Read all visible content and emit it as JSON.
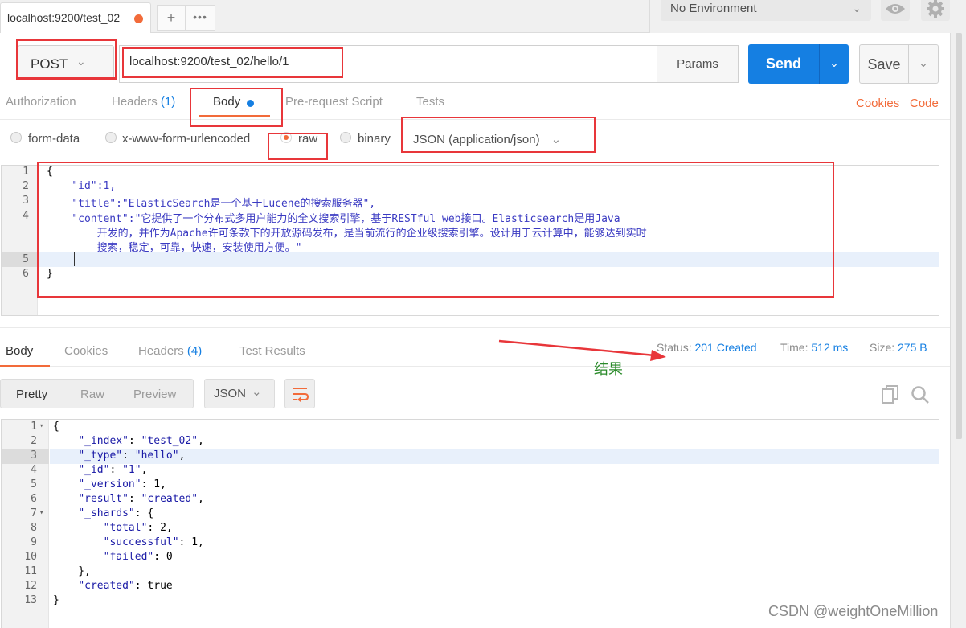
{
  "tabs": {
    "active_label": "localhost:9200/test_02",
    "add_label": "+",
    "more_label": "•••"
  },
  "env": {
    "selected": "No Environment"
  },
  "request": {
    "method": "POST",
    "url": "localhost:9200/test_02/hello/1",
    "params_label": "Params",
    "send_label": "Send",
    "save_label": "Save"
  },
  "req_tabs": {
    "authorization": "Authorization",
    "headers": "Headers",
    "headers_count": "(1)",
    "body": "Body",
    "prerequest": "Pre-request Script",
    "tests": "Tests",
    "cookies": "Cookies",
    "code": "Code"
  },
  "body_modes": {
    "form_data": "form-data",
    "urlencoded": "x-www-form-urlencoded",
    "raw": "raw",
    "binary": "binary",
    "content_type": "JSON (application/json)"
  },
  "request_body": {
    "line_numbers": [
      "1",
      "2",
      "3",
      "4",
      "5",
      "6"
    ],
    "lines": [
      "{",
      "    \"id\":1,",
      "    \"title\":\"ElasticSearch是一个基于Lucene的搜索服务器\",",
      "    \"content\":\"它提供了一个分布式多用户能力的全文搜索引擎，基于RESTful web接口。Elasticsearch是用Java",
      "        开发的，并作为Apache许可条款下的开放源码发布，是当前流行的企业级搜索引擎。设计用于云计算中，能够达到实时",
      "        搜索，稳定，可靠，快速，安装使用方便。\"",
      "",
      "}"
    ]
  },
  "response": {
    "tabs": {
      "body": "Body",
      "cookies": "Cookies",
      "headers": "Headers",
      "headers_count": "(4)",
      "test_results": "Test Results"
    },
    "status_label": "Status:",
    "status_value": "201 Created",
    "time_label": "Time:",
    "time_value": "512 ms",
    "size_label": "Size:",
    "size_value": "275 B",
    "annotation": "结果",
    "view_modes": {
      "pretty": "Pretty",
      "raw": "Raw",
      "preview": "Preview"
    },
    "format": "JSON",
    "line_numbers": [
      "1",
      "2",
      "3",
      "4",
      "5",
      "6",
      "7",
      "8",
      "9",
      "10",
      "11",
      "12",
      "13"
    ],
    "lines": [
      "{",
      "    \"_index\": \"test_02\",",
      "    \"_type\": \"hello\",",
      "    \"_id\": \"1\",",
      "    \"_version\": 1,",
      "    \"result\": \"created\",",
      "    \"_shards\": {",
      "        \"total\": 2,",
      "        \"successful\": 1,",
      "        \"failed\": 0",
      "    },",
      "    \"created\": true",
      "}"
    ]
  },
  "watermark": "CSDN @weightOneMillion"
}
